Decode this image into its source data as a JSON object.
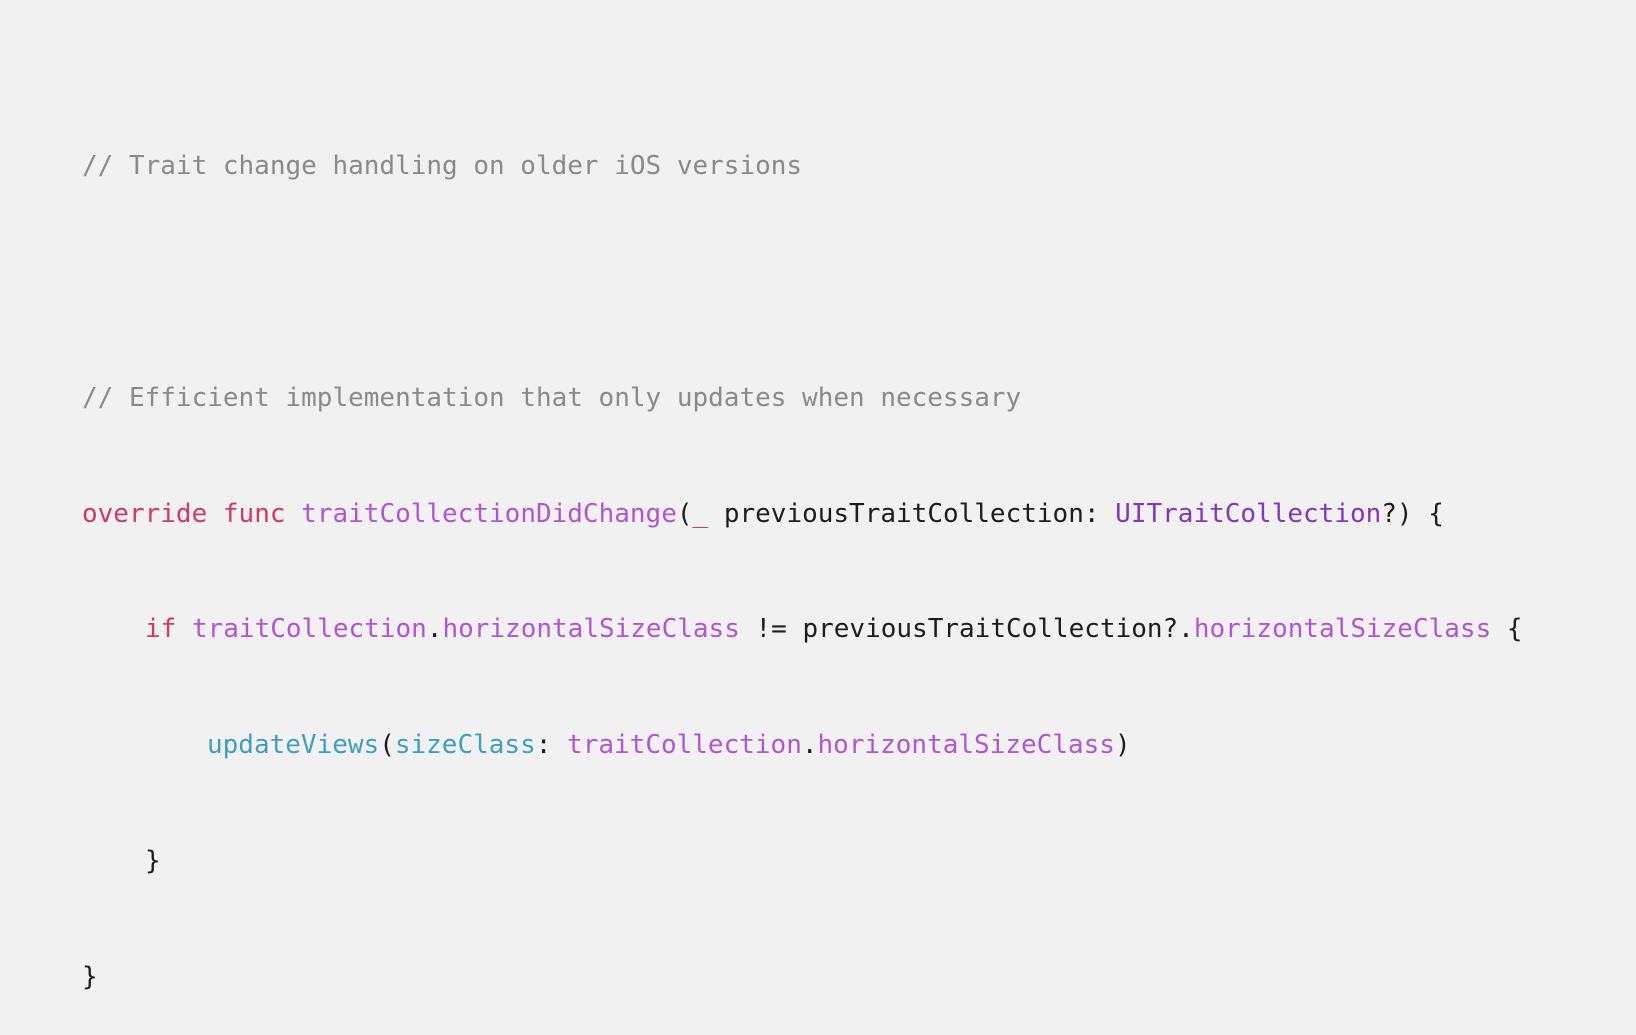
{
  "code": {
    "comment_1": "// Trait change handling on older iOS versions",
    "comment_2": "// Efficient implementation that only updates when necessary",
    "line_3": {
      "kw_override": "override",
      "kw_func": "func",
      "func_name": "traitCollectionDidChange",
      "paren_open": "(",
      "underscore": "_",
      "param": " previousTraitCollection: ",
      "type": "UITraitCollection",
      "tail": "?) {"
    },
    "line_4": {
      "kw_if": "if",
      "obj": "traitCollection",
      "dot": ".",
      "prop": "horizontalSizeClass",
      "op": " != previousTraitCollection?.",
      "prop2": "horizontalSizeClass",
      "brace": " {"
    },
    "line_5": {
      "call": "updateViews",
      "paren_open": "(",
      "label": "sizeClass",
      "colon": ": ",
      "obj": "traitCollection",
      "dot": ".",
      "prop": "horizontalSizeClass",
      "paren_close": ")"
    },
    "line_6": "}",
    "line_7": "}"
  },
  "colors": {
    "background": "#f1f1f1",
    "comment": "#8a8a8a",
    "keyword": "#d1376f",
    "function": "#b255d4",
    "type": "#8337c0",
    "call": "#3f9fbd",
    "text": "#1d1d1f"
  }
}
